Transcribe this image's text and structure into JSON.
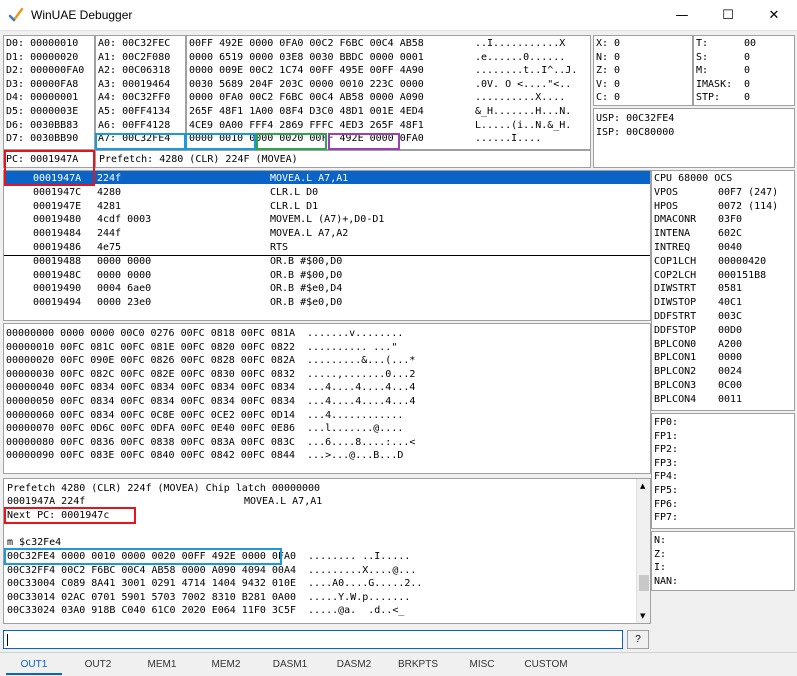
{
  "window": {
    "title": "WinUAE Debugger",
    "minimize": "—",
    "maximize": "☐",
    "close": "✕"
  },
  "dregs": [
    "D0: 00000010",
    "D1: 00000020",
    "D2: 000000FA0",
    "D3: 00000FA8",
    "D4: 00000001",
    "D5: 0000003E",
    "D6: 0030BB83",
    "D7: 0030BB90"
  ],
  "aregs": [
    "A0: 00C32FEC",
    "A1: 00C2F080",
    "A2: 00C06318",
    "A3: 00019464",
    "A4: 00C32FF0",
    "A5: 00FF4134",
    "A6: 00FF4128",
    "A7: 00C32FE4"
  ],
  "stackhex": [
    "00FF 492E 0000 0FA0 00C2 F6BC 00C4 AB58",
    "0000 6519 0000 03E8 0030 BBDC 0000 0001",
    "0000 009E 00C2 1C74 00FF 495E 00FF 4A90",
    "0030 5689 204F 203C 0000 0010 223C 0000",
    "0000 0FA0 00C2 F6BC 00C4 AB58 0000 A090",
    "265F 48F1 1A00 08F4 D3C0 48D1 001E 4ED4",
    "4CE9 0A00 FFF4 2869 FFFC 4ED3 265F 48F1",
    "0000 0010 0000 0020 00FF 492E 0000 0FA0"
  ],
  "stackascii": [
    "..I...........X",
    ".e......0......",
    "........t..I^..J.",
    ".0V. O <....\"<..",
    "..........X....",
    "&_H.......H...N.",
    "L.....(i..N.&_H.",
    "......I...."
  ],
  "flags": [
    "X: 0",
    "N: 0",
    "Z: 0",
    "V: 0",
    "C: 0"
  ],
  "status": [
    "T:",
    "S:",
    "M:",
    "IMASK:",
    "STP:"
  ],
  "status_vals": [
    "00",
    "0",
    "0",
    "0",
    "0"
  ],
  "usp": "USP: 00C32FE4",
  "isp": "ISP: 00C80000",
  "pc": "PC: 0001947A",
  "prefetch": "Prefetch: 4280 (CLR) 224F (MOVEA)",
  "disasm": [
    {
      "addr": "0001947A",
      "hex": "224f",
      "op": "MOVEA.L A7,A1"
    },
    {
      "addr": "0001947C",
      "hex": "4280",
      "op": "CLR.L D0"
    },
    {
      "addr": "0001947E",
      "hex": "4281",
      "op": "CLR.L D1"
    },
    {
      "addr": "00019480",
      "hex": "4cdf 0003",
      "op": "MOVEM.L (A7)+,D0-D1"
    },
    {
      "addr": "00019484",
      "hex": "244f",
      "op": "MOVEA.L A7,A2"
    },
    {
      "addr": "00019486",
      "hex": "4e75",
      "op": "RTS"
    },
    {
      "addr": "00019488",
      "hex": "0000 0000",
      "op": "OR.B #$00,D0"
    },
    {
      "addr": "0001948C",
      "hex": "0000 0000",
      "op": "OR.B #$00,D0"
    },
    {
      "addr": "00019490",
      "hex": "0004 6ae0",
      "op": "OR.B #$e0,D4"
    },
    {
      "addr": "00019494",
      "hex": "0000 23e0",
      "op": "OR.B #$e0,D0"
    }
  ],
  "custom": [
    [
      "CPU 68000 OCS",
      ""
    ],
    [
      "VPOS",
      "00F7 (247)"
    ],
    [
      "HPOS",
      "0072 (114)"
    ],
    [
      "DMACONR",
      "03F0"
    ],
    [
      "INTENA",
      "602C"
    ],
    [
      "INTREQ",
      "0040"
    ],
    [
      "COP1LCH",
      "00000420"
    ],
    [
      "COP2LCH",
      "000151B8"
    ],
    [
      "DIWSTRT",
      "0581"
    ],
    [
      "DIWSTOP",
      "40C1"
    ],
    [
      "DDFSTRT",
      "003C"
    ],
    [
      "DDFSTOP",
      "00D0"
    ],
    [
      "BPLCON0",
      "A200"
    ],
    [
      "BPLCON1",
      "0000"
    ],
    [
      "BPLCON2",
      "0024"
    ],
    [
      "BPLCON3",
      "0C00"
    ],
    [
      "BPLCON4",
      "0011"
    ]
  ],
  "memdump": [
    "00000000 0000 0000 00C0 0276 00FC 0818 00FC 081A  .......v........",
    "00000010 00FC 081C 00FC 081E 00FC 0820 00FC 0822  .......... ...\"",
    "00000020 00FC 090E 00FC 0826 00FC 0828 00FC 082A  .........&...(...*",
    "00000030 00FC 082C 00FC 082E 00FC 0830 00FC 0832  .....,.......0...2",
    "00000040 00FC 0834 00FC 0834 00FC 0834 00FC 0834  ...4....4....4...4",
    "00000050 00FC 0834 00FC 0834 00FC 0834 00FC 0834  ...4....4....4...4",
    "00000060 00FC 0834 00FC 0C8E 00FC 0CE2 00FC 0D14  ...4............",
    "00000070 00FC 0D6C 00FC 0DFA 00FC 0E40 00FC 0E86  ...l.......@....",
    "00000080 00FC 0836 00FC 0838 00FC 083A 00FC 083C  ...6....8....:...<",
    "00000090 00FC 083E 00FC 0840 00FC 0842 00FC 0844  ...>...@...B...D"
  ],
  "fpregs": [
    "FP0:",
    "FP1:",
    "FP2:",
    "FP3:",
    "FP4:",
    "FP5:",
    "FP6:",
    "FP7:"
  ],
  "fpflags": [
    "N:",
    "Z:",
    "I:",
    "NAN:"
  ],
  "output": {
    "line1": "Prefetch 4280 (CLR) 224f (MOVEA) Chip latch 00000000",
    "line2a": "0001947A 224f",
    "line2b": "MOVEA.L A7,A1",
    "nextpc": "Next PC: 0001947c",
    "cmd": "m $c32Fe4",
    "dump": [
      "00C32FE4 0000 0010 0000 0020 00FF 492E 0000 0FA0  ........ ..I.....",
      "00C32FF4 00C2 F6BC 00C4 AB58 0000 A090 4094 00A4  .........X....@...",
      "00C33004 C089 8A41 3001 0291 4714 1404 9432 010E  ....A0....G.....2..",
      "00C33014 02AC 0701 5901 5703 7002 8310 B281 0A00  .....Y.W.p.......",
      "00C33024 03A0 918B C040 61C0 2020 E064 11F0 3C5F  .....@a.  .d..<_"
    ]
  },
  "input": {
    "value": "",
    "help": "?"
  },
  "tabs": [
    "OUT1",
    "OUT2",
    "MEM1",
    "MEM2",
    "DASM1",
    "DASM2",
    "BRKPTS",
    "MISC",
    "CUSTOM"
  ]
}
